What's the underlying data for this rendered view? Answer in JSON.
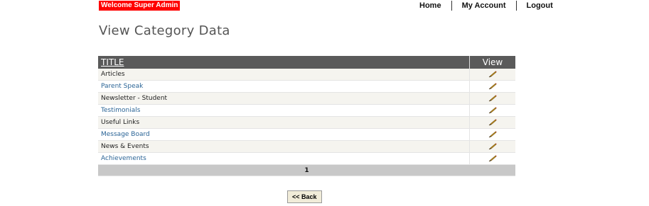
{
  "header": {
    "welcome": "Welcome Super Admin",
    "nav": [
      "Home",
      "My Account",
      "Logout"
    ]
  },
  "page_title": "View Category Data",
  "table": {
    "columns": [
      "TITLE",
      "View"
    ],
    "rows": [
      "Articles",
      "Parent Speak",
      "Newsletter - Student",
      "Testimonials",
      "Useful Links",
      "Message Board",
      "News & Events",
      "Achievements"
    ],
    "edit_icon": "pencil-icon",
    "page": "1"
  },
  "back_button": "<< Back",
  "colors": {
    "welcome_bg": "#ff0000",
    "header_bg": "#5a5a5a",
    "link": "#2a6496"
  }
}
